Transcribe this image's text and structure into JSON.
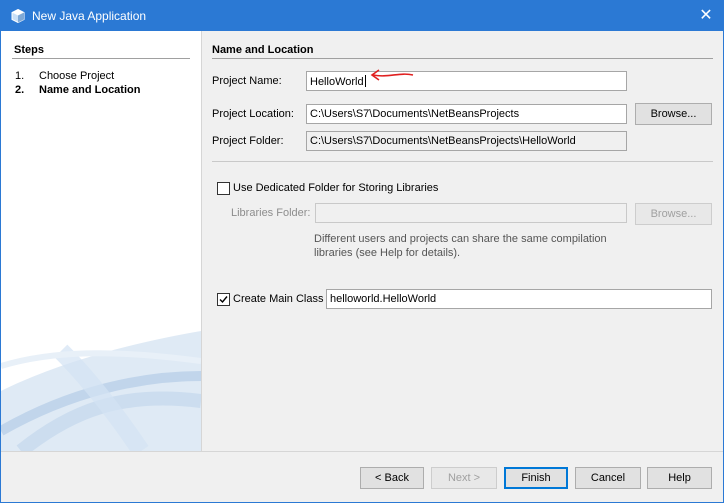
{
  "window": {
    "title": "New Java Application",
    "close_glyph": "✕"
  },
  "steps": {
    "title": "Steps",
    "items": [
      {
        "num": "1.",
        "label": "Choose Project"
      },
      {
        "num": "2.",
        "label": "Name and Location"
      }
    ]
  },
  "section": {
    "title": "Name and Location"
  },
  "form": {
    "project_name": {
      "label": "Project Name:",
      "value": "HelloWorld"
    },
    "project_location": {
      "label": "Project Location:",
      "value": "C:\\Users\\S7\\Documents\\NetBeansProjects",
      "browse": "Browse..."
    },
    "project_folder": {
      "label": "Project Folder:",
      "value": "C:\\Users\\S7\\Documents\\NetBeansProjects\\HelloWorld"
    },
    "dedicated_folder": {
      "label": "Use Dedicated Folder for Storing Libraries",
      "checked": false
    },
    "libraries_folder": {
      "label": "Libraries Folder:",
      "value": "",
      "browse": "Browse..."
    },
    "hint": "Different users and projects can share the same compilation libraries (see Help for details).",
    "create_main_class": {
      "label": "Create Main Class",
      "value": "helloworld.HelloWorld",
      "checked": true
    }
  },
  "buttons": {
    "back": "< Back",
    "next": "Next >",
    "finish": "Finish",
    "cancel": "Cancel",
    "help": "Help"
  },
  "colors": {
    "title_bar": "#2b79d4",
    "annotation_arrow": "#e02020",
    "default_button_border": "#0078d7"
  },
  "icons": {
    "app": "java-cube-icon",
    "close": "close-icon",
    "checkmark": "checkmark-icon",
    "annotation": "red-arrow-annotation"
  }
}
